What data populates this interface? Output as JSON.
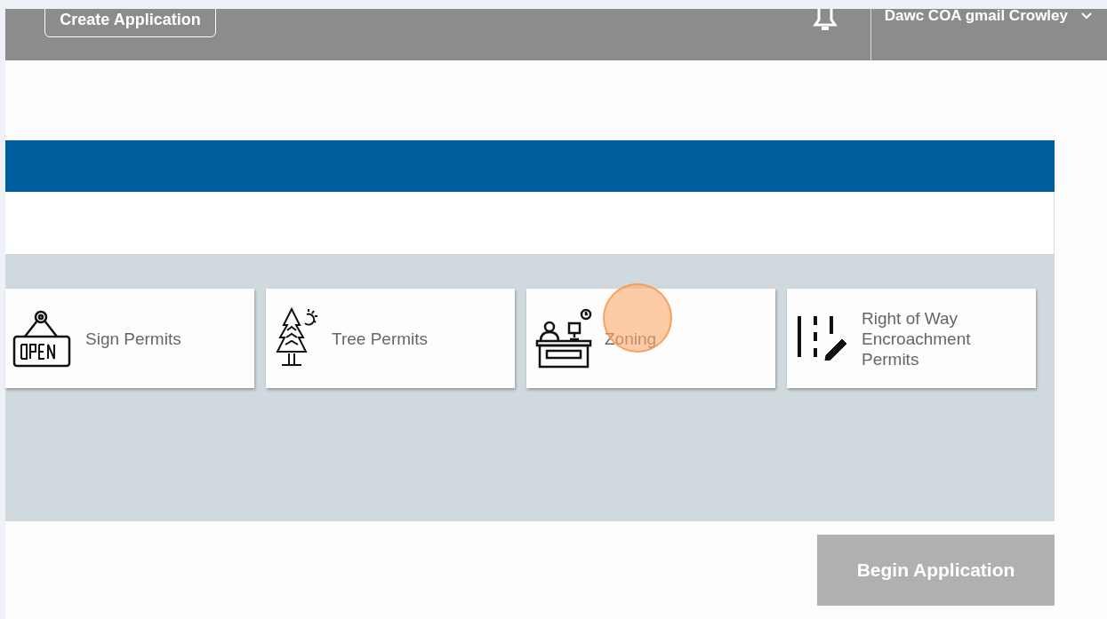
{
  "header": {
    "create_button": "Create Application",
    "user_name": "Dawc COA gmail Crowley"
  },
  "permit_types": [
    {
      "kind": "sign",
      "label": "Sign Permits",
      "selected": false
    },
    {
      "kind": "tree",
      "label": "Tree Permits",
      "selected": false
    },
    {
      "kind": "zoning",
      "label": "Zoning",
      "selected": false
    },
    {
      "kind": "row",
      "label": "Right of Way Encroachment Permits",
      "selected": false
    }
  ],
  "begin_button": {
    "label": "Begin Application",
    "disabled": true
  }
}
